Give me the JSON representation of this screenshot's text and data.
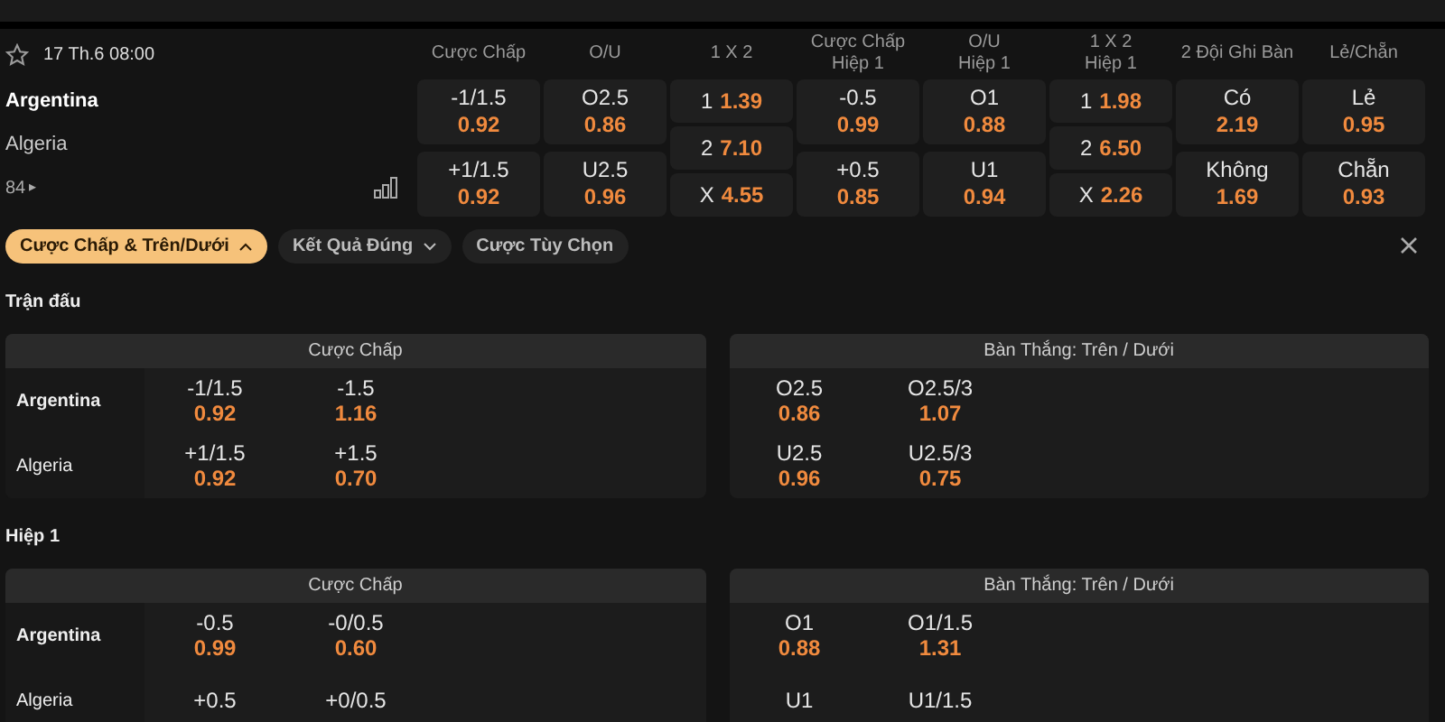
{
  "match": {
    "datetime": "17 Th.6 08:00",
    "teams": [
      "Argentina",
      "Algeria"
    ],
    "more_count": "84",
    "more_arrow": "▸"
  },
  "market_columns": [
    {
      "title": "Cược Chấp",
      "kind": "pair",
      "cells": [
        {
          "line": "-1/1.5",
          "odds": "0.92"
        },
        {
          "line": "+1/1.5",
          "odds": "0.92"
        }
      ]
    },
    {
      "title": "O/U",
      "kind": "pair",
      "cells": [
        {
          "line": "O2.5",
          "odds": "0.86"
        },
        {
          "line": "U2.5",
          "odds": "0.96"
        }
      ]
    },
    {
      "title": "1 X 2",
      "kind": "triple",
      "cells": [
        {
          "line": "1",
          "odds": "1.39"
        },
        {
          "line": "2",
          "odds": "7.10"
        },
        {
          "line": "X",
          "odds": "4.55"
        }
      ]
    },
    {
      "title": "Cược Chấp",
      "subtitle": "Hiệp 1",
      "kind": "pair",
      "cells": [
        {
          "line": "-0.5",
          "odds": "0.99"
        },
        {
          "line": "+0.5",
          "odds": "0.85"
        }
      ]
    },
    {
      "title": "O/U",
      "subtitle": "Hiệp 1",
      "kind": "pair",
      "cells": [
        {
          "line": "O1",
          "odds": "0.88"
        },
        {
          "line": "U1",
          "odds": "0.94"
        }
      ]
    },
    {
      "title": "1 X 2",
      "subtitle": "Hiệp 1",
      "kind": "triple",
      "cells": [
        {
          "line": "1",
          "odds": "1.98"
        },
        {
          "line": "2",
          "odds": "6.50"
        },
        {
          "line": "X",
          "odds": "2.26"
        }
      ]
    },
    {
      "title": "2 Đội Ghi Bàn",
      "kind": "pair",
      "cells": [
        {
          "line": "Có",
          "odds": "2.19"
        },
        {
          "line": "Không",
          "odds": "1.69"
        }
      ]
    },
    {
      "title": "Lẻ/Chẵn",
      "kind": "pair",
      "cells": [
        {
          "line": "Lẻ",
          "odds": "0.95"
        },
        {
          "line": "Chẵn",
          "odds": "0.93"
        }
      ]
    }
  ],
  "filters": [
    {
      "label": "Cược Chấp & Trên/Dưới",
      "selected": true,
      "expanded": true
    },
    {
      "label": "Kết Quả Đúng",
      "selected": false,
      "expanded": false
    },
    {
      "label": "Cược Tùy Chọn",
      "selected": false
    }
  ],
  "sections": [
    {
      "title": "Trận đấu",
      "teams": [
        "Argentina",
        "Algeria"
      ],
      "panels": [
        {
          "title": "Cược Chấp",
          "rows": [
            [
              {
                "line": "-1/1.5",
                "odds": "0.92"
              },
              {
                "line": "-1.5",
                "odds": "1.16"
              }
            ],
            [
              {
                "line": "+1/1.5",
                "odds": "0.92"
              },
              {
                "line": "+1.5",
                "odds": "0.70"
              }
            ]
          ]
        },
        {
          "title": "Bàn Thắng: Trên / Dưới",
          "rows": [
            [
              {
                "line": "O2.5",
                "odds": "0.86"
              },
              {
                "line": "O2.5/3",
                "odds": "1.07"
              }
            ],
            [
              {
                "line": "U2.5",
                "odds": "0.96"
              },
              {
                "line": "U2.5/3",
                "odds": "0.75"
              }
            ]
          ]
        }
      ]
    },
    {
      "title": "Hiệp 1",
      "teams": [
        "Argentina",
        "Algeria"
      ],
      "panels": [
        {
          "title": "Cược Chấp",
          "rows": [
            [
              {
                "line": "-0.5",
                "odds": "0.99"
              },
              {
                "line": "-0/0.5",
                "odds": "0.60"
              }
            ],
            [
              {
                "line": "+0.5"
              },
              {
                "line": "+0/0.5"
              }
            ]
          ]
        },
        {
          "title": "Bàn Thắng: Trên / Dưới",
          "rows": [
            [
              {
                "line": "O1",
                "odds": "0.88"
              },
              {
                "line": "O1/1.5",
                "odds": "1.31"
              }
            ],
            [
              {
                "line": "U1"
              },
              {
                "line": "U1/1.5"
              }
            ]
          ]
        }
      ]
    }
  ]
}
